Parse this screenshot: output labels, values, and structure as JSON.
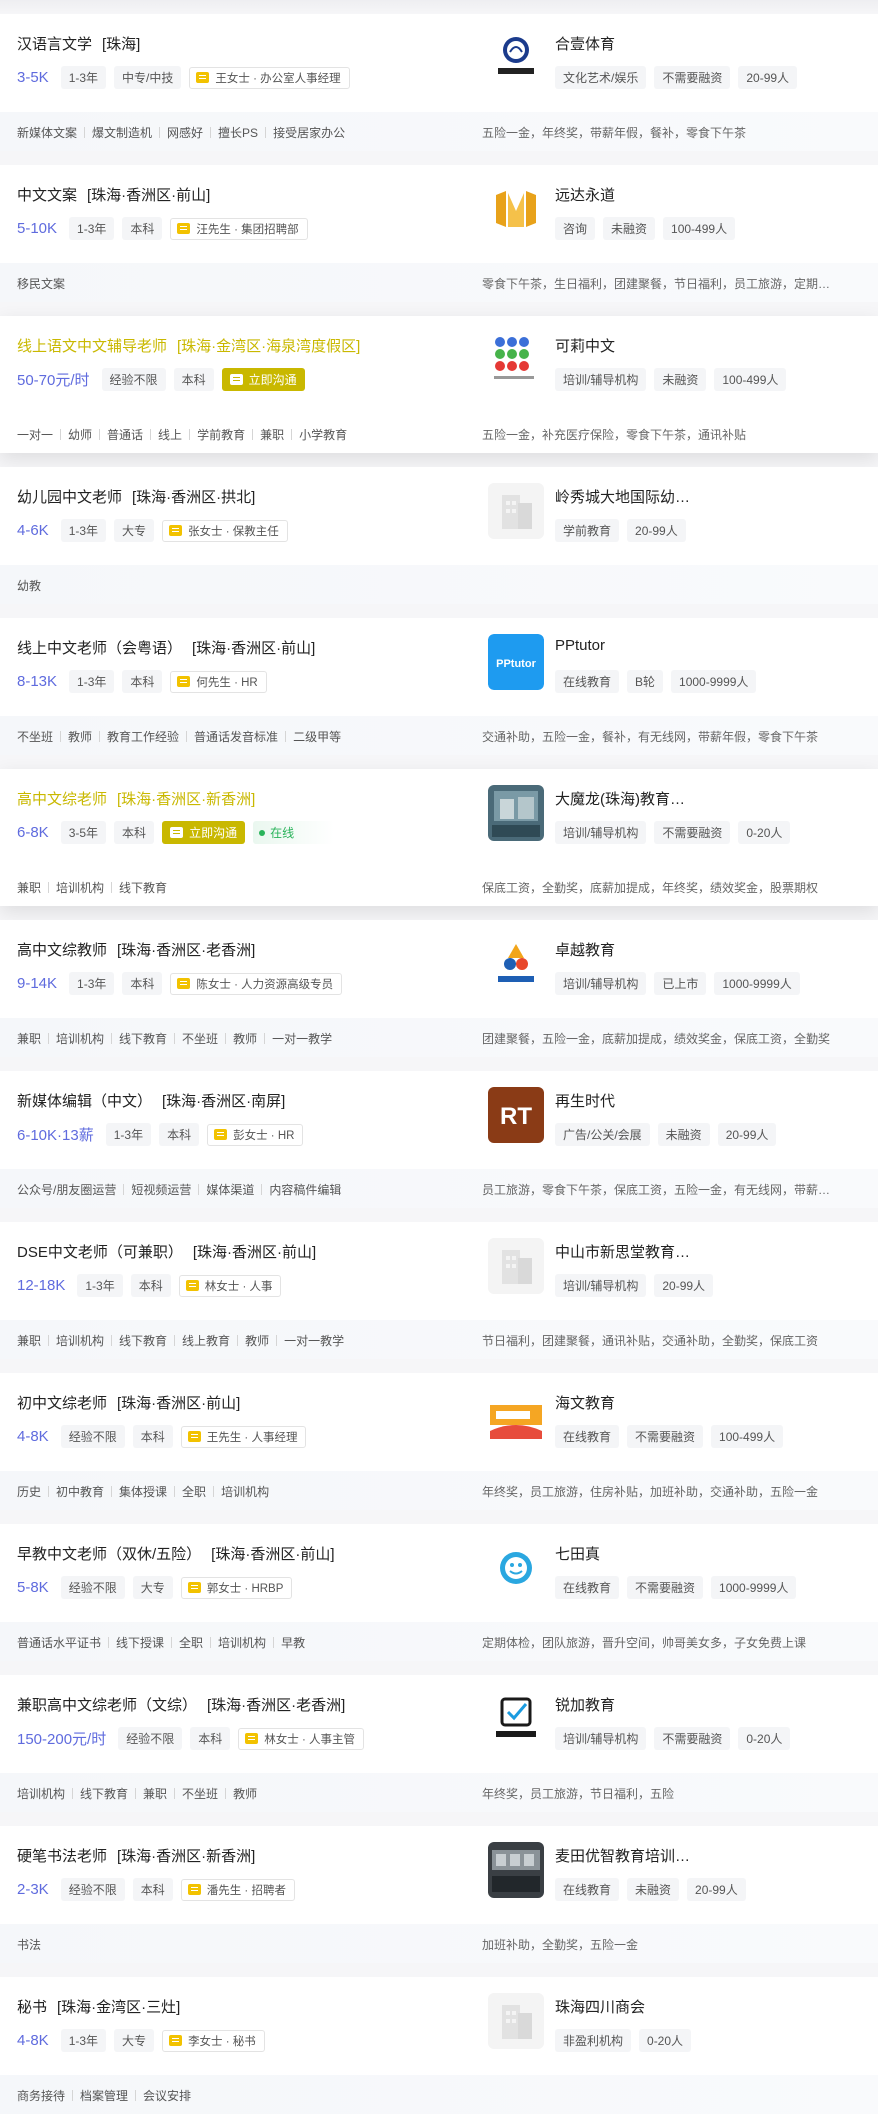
{
  "jobs": [
    {
      "title": "汉语言文学",
      "area": "[珠海]",
      "salary": "3-5K",
      "tags": [
        "1-3年",
        "中专/中技"
      ],
      "recruiter": "王女士 · 办公室人事经理",
      "skills": [
        "新媒体文案",
        "爆文制造机",
        "网感好",
        "擅长PS",
        "接受居家办公"
      ],
      "company": "合壹体育",
      "company_tags": [
        "文化艺术/娱乐",
        "不需要融资",
        "20-99人"
      ],
      "benefits": "五险一金，年终奖，带薪年假，餐补，零食下午茶",
      "logo": "heyi-logo"
    },
    {
      "title": "中文文案",
      "area": "[珠海·香洲区·前山]",
      "salary": "5-10K",
      "tags": [
        "1-3年",
        "本科"
      ],
      "recruiter": "汪先生 · 集团招聘部",
      "skills": [
        "移民文案"
      ],
      "company": "远达永道",
      "company_tags": [
        "咨询",
        "未融资",
        "100-499人"
      ],
      "benefits": "零食下午茶，生日福利，团建聚餐，节日福利，员工旅游，定期体检",
      "logo": "yuanda-logo"
    },
    {
      "title": "线上语文中文辅导老师",
      "area": "[珠海·金湾区·海泉湾度假区]",
      "salary": "50-70元/时",
      "tags": [
        "经验不限",
        "本科"
      ],
      "chat_label": "立即沟通",
      "skills": [
        "一对一",
        "幼师",
        "普通话",
        "线上",
        "学前教育",
        "兼职",
        "小学教育"
      ],
      "company": "可莉中文",
      "company_tags": [
        "培训/辅导机构",
        "未融资",
        "100-499人"
      ],
      "benefits": "五险一金，补充医疗保险，零食下午茶，通讯补贴",
      "logo": "keli-logo",
      "highlight": true
    },
    {
      "title": "幼儿园中文老师",
      "area": "[珠海·香洲区·拱北]",
      "salary": "4-6K",
      "tags": [
        "1-3年",
        "大专"
      ],
      "recruiter": "张女士 · 保教主任",
      "skills": [
        "幼教"
      ],
      "company": "岭秀城大地国际幼稚园",
      "company_tags": [
        "学前教育",
        "20-99人"
      ],
      "benefits": "",
      "logo": "placeholder-logo"
    },
    {
      "title": "线上中文老师（会粤语）",
      "area": "[珠海·香洲区·前山]",
      "salary": "8-13K",
      "tags": [
        "1-3年",
        "本科"
      ],
      "recruiter": "何先生 · HR",
      "skills": [
        "不坐班",
        "教师",
        "教育工作经验",
        "普通话发音标准",
        "二级甲等"
      ],
      "company": "PPtutor",
      "company_tags": [
        "在线教育",
        "B轮",
        "1000-9999人"
      ],
      "benefits": "交通补助，五险一金，餐补，有无线网，带薪年假，零食下午茶",
      "logo": "pptutor-logo"
    },
    {
      "title": "高中文综老师",
      "area": "[珠海·香洲区·新香洲]",
      "salary": "6-8K",
      "tags": [
        "3-5年",
        "本科"
      ],
      "chat_label": "立即沟通",
      "online_label": "在线",
      "skills": [
        "兼职",
        "培训机构",
        "线下教育"
      ],
      "company": "大魔龙(珠海)教育科技",
      "company_tags": [
        "培训/辅导机构",
        "不需要融资",
        "0-20人"
      ],
      "benefits": "保底工资，全勤奖，底薪加提成，年终奖，绩效奖金，股票期权",
      "logo": "photo-logo",
      "highlight": true
    },
    {
      "title": "高中文综教师",
      "area": "[珠海·香洲区·老香洲]",
      "salary": "9-14K",
      "tags": [
        "1-3年",
        "本科"
      ],
      "recruiter": "陈女士 · 人力资源高级专员",
      "skills": [
        "兼职",
        "培训机构",
        "线下教育",
        "不坐班",
        "教师",
        "一对一教学"
      ],
      "company": "卓越教育",
      "company_tags": [
        "培训/辅导机构",
        "已上市",
        "1000-9999人"
      ],
      "benefits": "团建聚餐，五险一金，底薪加提成，绩效奖金，保底工资，全勤奖",
      "logo": "zhuoyue-logo"
    },
    {
      "title": "新媒体编辑（中文）",
      "area": "[珠海·香洲区·南屏]",
      "salary": "6-10K·13薪",
      "tags": [
        "1-3年",
        "本科"
      ],
      "recruiter": "彭女士 · HR",
      "skills": [
        "公众号/朋友圈运营",
        "短视频运营",
        "媒体渠道",
        "内容稿件编辑"
      ],
      "company": "再生时代",
      "company_tags": [
        "广告/公关/会展",
        "未融资",
        "20-99人"
      ],
      "benefits": "员工旅游，零食下午茶，保底工资，五险一金，有无线网，带薪年假",
      "logo": "rt-logo"
    },
    {
      "title": "DSE中文老师（可兼职）",
      "area": "[珠海·香洲区·前山]",
      "salary": "12-18K",
      "tags": [
        "1-3年",
        "本科"
      ],
      "recruiter": "林女士 · 人事",
      "skills": [
        "兼职",
        "培训机构",
        "线下教育",
        "线上教育",
        "教师",
        "一对一教学"
      ],
      "company": "中山市新思堂教育科技",
      "company_tags": [
        "培训/辅导机构",
        "20-99人"
      ],
      "benefits": "节日福利，团建聚餐，通讯补贴，交通补助，全勤奖，保底工资",
      "logo": "placeholder-logo"
    },
    {
      "title": "初中文综老师",
      "area": "[珠海·香洲区·前山]",
      "salary": "4-8K",
      "tags": [
        "经验不限",
        "本科"
      ],
      "recruiter": "王先生 · 人事经理",
      "skills": [
        "历史",
        "初中教育",
        "集体授课",
        "全职",
        "培训机构"
      ],
      "company": "海文教育",
      "company_tags": [
        "在线教育",
        "不需要融资",
        "100-499人"
      ],
      "benefits": "年终奖，员工旅游，住房补贴，加班补助，交通补助，五险一金",
      "logo": "haiwen-logo"
    },
    {
      "title": "早教中文老师（双休/五险）",
      "area": "[珠海·香洲区·前山]",
      "salary": "5-8K",
      "tags": [
        "经验不限",
        "大专"
      ],
      "recruiter": "郭女士 · HRBP",
      "skills": [
        "普通话水平证书",
        "线下授课",
        "全职",
        "培训机构",
        "早教"
      ],
      "company": "七田真",
      "company_tags": [
        "在线教育",
        "不需要融资",
        "1000-9999人"
      ],
      "benefits": "定期体检，团队旅游，晋升空间，帅哥美女多，子女免费上课",
      "logo": "qitian-logo"
    },
    {
      "title": "兼职高中文综老师（文综）",
      "area": "[珠海·香洲区·老香洲]",
      "salary": "150-200元/时",
      "tags": [
        "经验不限",
        "本科"
      ],
      "recruiter": "林女士 · 人事主管",
      "skills": [
        "培训机构",
        "线下教育",
        "兼职",
        "不坐班",
        "教师"
      ],
      "company": "锐加教育",
      "company_tags": [
        "培训/辅导机构",
        "不需要融资",
        "0-20人"
      ],
      "benefits": "年终奖，员工旅游，节日福利，五险",
      "logo": "ruijia-logo"
    },
    {
      "title": "硬笔书法老师",
      "area": "[珠海·香洲区·新香洲]",
      "salary": "2-3K",
      "tags": [
        "经验不限",
        "本科"
      ],
      "recruiter": "潘先生 · 招聘者",
      "skills": [
        "书法"
      ],
      "company": "麦田优智教育培训中心",
      "company_tags": [
        "在线教育",
        "未融资",
        "20-99人"
      ],
      "benefits": "加班补助，全勤奖，五险一金",
      "logo": "room-logo"
    },
    {
      "title": "秘书",
      "area": "[珠海·金湾区·三灶]",
      "salary": "4-8K",
      "tags": [
        "1-3年",
        "大专"
      ],
      "recruiter": "李女士 · 秘书",
      "skills": [
        "商务接待",
        "档案管理",
        "会议安排"
      ],
      "company": "珠海四川商会",
      "company_tags": [
        "非盈利机构",
        "0-20人"
      ],
      "benefits": "",
      "logo": "placeholder-logo"
    }
  ],
  "colors": {
    "salary": "#5f6bde",
    "highlight_title": "#c9b800",
    "chat_button": "#c9b800",
    "online": "#29b35a",
    "page_bg": "#f6f6f8"
  }
}
